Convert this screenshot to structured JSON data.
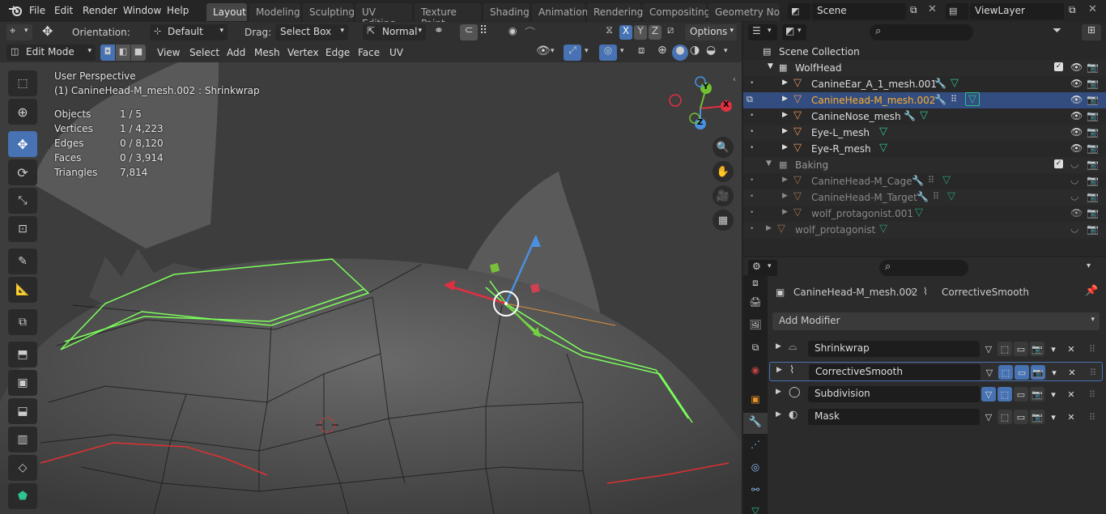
{
  "menubar": {
    "items": [
      "File",
      "Edit",
      "Render",
      "Window",
      "Help"
    ],
    "workspaces": [
      "Layout",
      "Modeling",
      "Sculpting",
      "UV Editing",
      "Texture Paint",
      "Shading",
      "Animation",
      "Rendering",
      "Compositing",
      "Geometry Nod"
    ],
    "active_workspace": "Layout",
    "scene": "Scene",
    "view_layer": "ViewLayer"
  },
  "toolbar": {
    "orientation_label": "Orientation:",
    "orientation_value": "Default",
    "drag_label": "Drag:",
    "drag_value": "Select Box",
    "pivot_value": "Normal",
    "axis_x": "X",
    "axis_y": "Y",
    "axis_z": "Z",
    "options_label": "Options"
  },
  "header": {
    "mode": "Edit Mode",
    "menus": [
      "View",
      "Select",
      "Add",
      "Mesh",
      "Vertex",
      "Edge",
      "Face",
      "UV"
    ]
  },
  "viewport": {
    "perspective": "User Perspective",
    "object_info": "(1) CanineHead-M_mesh.002 : Shrinkwrap",
    "stats": [
      {
        "label": "Objects",
        "value": "1 / 5"
      },
      {
        "label": "Vertices",
        "value": "1 / 4,223"
      },
      {
        "label": "Edges",
        "value": "0 / 8,120"
      },
      {
        "label": "Faces",
        "value": "0 / 3,914"
      },
      {
        "label": "Triangles",
        "value": "7,814"
      }
    ],
    "gizmo_x": "X",
    "gizmo_y": "Y",
    "gizmo_z": "Z"
  },
  "outliner": {
    "root": "Scene Collection",
    "rows": [
      {
        "label": "WolfHead",
        "type": "collection"
      },
      {
        "label": "CanineEar_A_1_mesh.001",
        "type": "mesh"
      },
      {
        "label": "CanineHead-M_mesh.002",
        "type": "mesh"
      },
      {
        "label": "CanineNose_mesh",
        "type": "mesh"
      },
      {
        "label": "Eye-L_mesh",
        "type": "mesh"
      },
      {
        "label": "Eye-R_mesh",
        "type": "mesh"
      },
      {
        "label": "Baking",
        "type": "collection"
      },
      {
        "label": "CanineHead-M_Cage",
        "type": "mesh"
      },
      {
        "label": "CanineHead-M_Target",
        "type": "mesh"
      },
      {
        "label": "wolf_protagonist.001",
        "type": "mesh"
      },
      {
        "label": "wolf_protagonist",
        "type": "mesh"
      }
    ]
  },
  "properties": {
    "object_name": "CanineHead-M_mesh.002",
    "active_modifier": "CorrectiveSmooth",
    "add_modifier_label": "Add Modifier",
    "modifiers": [
      "Shrinkwrap",
      "CorrectiveSmooth",
      "Subdivision",
      "Mask"
    ]
  },
  "colors": {
    "accent": "#4772b3",
    "selected_row": "#334d80",
    "selected_text": "#ffaf29",
    "mesh_icon": "#e3905a",
    "vertex_group": "#2ec38f",
    "edge_select": "#7cff5a",
    "seam": "#e03030"
  }
}
